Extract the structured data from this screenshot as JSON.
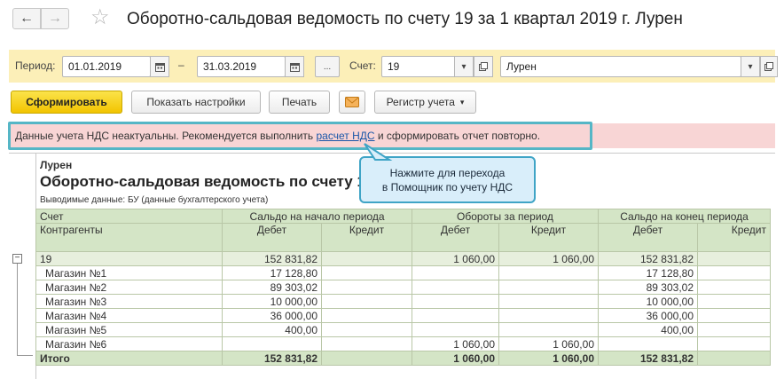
{
  "window": {
    "title": "Оборотно-сальдовая ведомость по счету 19 за 1 квартал 2019 г. Лурен",
    "back_glyph": "←",
    "forward_glyph": "→",
    "favorite_glyph": "☆"
  },
  "params": {
    "period_label": "Период:",
    "date_from": "01.01.2019",
    "dash": "–",
    "date_to": "31.03.2019",
    "more_button": "...",
    "account_label": "Счет:",
    "account": "19",
    "organization": "Лурен"
  },
  "toolbar": {
    "generate": "Сформировать",
    "show_settings": "Показать настройки",
    "print": "Печать",
    "register": "Регистр учета"
  },
  "warning": {
    "before": "Данные учета НДС неактуальны. Рекомендуется выполнить ",
    "link": "расчет НДС",
    "after": " и сформировать отчет повторно."
  },
  "tooltip": {
    "line1": "Нажмите для перехода",
    "line2": "в Помощник по учету НДС"
  },
  "report": {
    "organization": "Лурен",
    "title": "Оборотно-сальдовая ведомость по счету 19",
    "output_data": "Выводимые данные:  БУ (данные бухгалтерского учета)",
    "headers": {
      "account": "Счет",
      "counterparties": "Контрагенты",
      "opening": "Сальдо на начало периода",
      "turnover": "Обороты за период",
      "closing": "Сальдо на конец периода",
      "debit": "Дебет",
      "credit": "Кредит"
    },
    "account_row": {
      "name": "19",
      "open_debit": "152 831,82",
      "open_credit": "",
      "turn_debit": "1 060,00",
      "turn_credit": "1 060,00",
      "close_debit": "152 831,82",
      "close_credit": ""
    },
    "rows": [
      {
        "name": "Магазин №1",
        "open_debit": "17 128,80",
        "open_credit": "",
        "turn_debit": "",
        "turn_credit": "",
        "close_debit": "17 128,80",
        "close_credit": ""
      },
      {
        "name": "Магазин №2",
        "open_debit": "89 303,02",
        "open_credit": "",
        "turn_debit": "",
        "turn_credit": "",
        "close_debit": "89 303,02",
        "close_credit": ""
      },
      {
        "name": "Магазин №3",
        "open_debit": "10 000,00",
        "open_credit": "",
        "turn_debit": "",
        "turn_credit": "",
        "close_debit": "10 000,00",
        "close_credit": ""
      },
      {
        "name": "Магазин №4",
        "open_debit": "36 000,00",
        "open_credit": "",
        "turn_debit": "",
        "turn_credit": "",
        "close_debit": "36 000,00",
        "close_credit": ""
      },
      {
        "name": "Магазин №5",
        "open_debit": "400,00",
        "open_credit": "",
        "turn_debit": "",
        "turn_credit": "",
        "close_debit": "400,00",
        "close_credit": ""
      },
      {
        "name": "Магазин №6",
        "open_debit": "",
        "open_credit": "",
        "turn_debit": "1 060,00",
        "turn_credit": "1 060,00",
        "close_debit": "",
        "close_credit": ""
      }
    ],
    "total_row": {
      "name": "Итого",
      "open_debit": "152 831,82",
      "open_credit": "",
      "turn_debit": "1 060,00",
      "turn_credit": "1 060,00",
      "close_debit": "152 831,82",
      "close_credit": ""
    }
  },
  "colors": {
    "params_bg": "#fcefb8",
    "warning_bg": "#f8d5d5",
    "highlight_frame": "#55b6c6",
    "tooltip_bg": "#d9eefa",
    "table_header_bg": "#d4e5c6",
    "primary_button": "#f2c400",
    "link": "#1a56a8"
  }
}
